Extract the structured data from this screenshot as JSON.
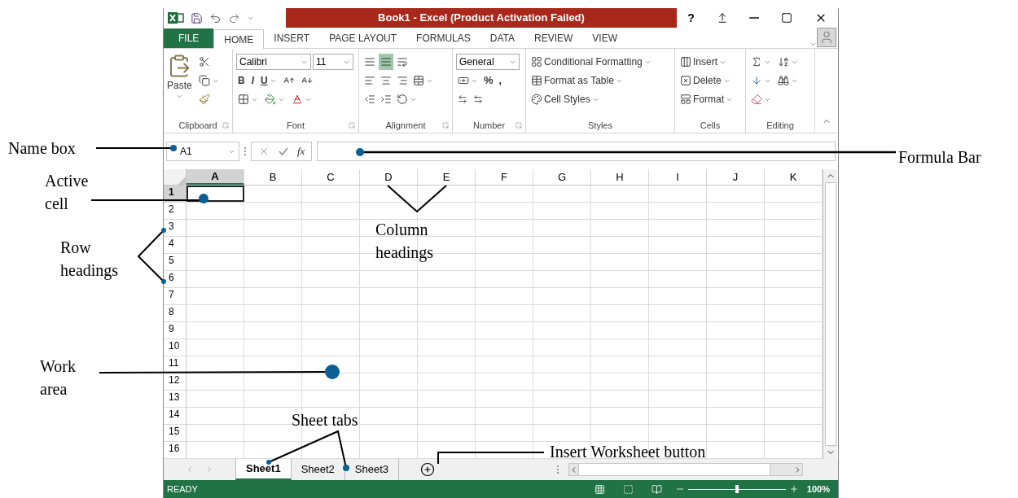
{
  "title_bar": {
    "title": "Book1 -  Excel (Product Activation Failed)",
    "help": "?"
  },
  "tabs": [
    {
      "label": "FILE",
      "kind": "file",
      "selected": false
    },
    {
      "label": "HOME",
      "kind": "tab",
      "selected": true
    },
    {
      "label": "INSERT",
      "kind": "tab",
      "selected": false
    },
    {
      "label": "PAGE LAYOUT",
      "kind": "tab",
      "selected": false
    },
    {
      "label": "FORMULAS",
      "kind": "tab",
      "selected": false
    },
    {
      "label": "DATA",
      "kind": "tab",
      "selected": false
    },
    {
      "label": "REVIEW",
      "kind": "tab",
      "selected": false
    },
    {
      "label": "VIEW",
      "kind": "tab",
      "selected": false
    }
  ],
  "ribbon": {
    "clipboard": {
      "label": "Clipboard",
      "paste": "Paste"
    },
    "font": {
      "label": "Font",
      "font_name": "Calibri",
      "font_size": "11",
      "bold": "B",
      "italic": "I",
      "underline": "U"
    },
    "alignment": {
      "label": "Alignment"
    },
    "number": {
      "label": "Number",
      "format": "General",
      "percent": "%",
      "comma": ","
    },
    "styles": {
      "label": "Styles",
      "items": [
        "Conditional Formatting",
        "Format as Table",
        "Cell Styles"
      ]
    },
    "cells": {
      "label": "Cells",
      "items": [
        "Insert",
        "Delete",
        "Format"
      ]
    },
    "editing": {
      "label": "Editing"
    }
  },
  "formula_bar": {
    "name_box": "A1",
    "function_label": "fx"
  },
  "columns": [
    {
      "label": "A",
      "selected": true
    },
    {
      "label": "B",
      "selected": false
    },
    {
      "label": "C",
      "selected": false
    },
    {
      "label": "D",
      "selected": false
    },
    {
      "label": "E",
      "selected": false
    },
    {
      "label": "F",
      "selected": false
    },
    {
      "label": "G",
      "selected": false
    },
    {
      "label": "H",
      "selected": false
    },
    {
      "label": "I",
      "selected": false
    },
    {
      "label": "J",
      "selected": false
    },
    {
      "label": "K",
      "selected": false
    }
  ],
  "rows": [
    {
      "label": "1",
      "selected": true
    },
    {
      "label": "2",
      "selected": false
    },
    {
      "label": "3",
      "selected": false
    },
    {
      "label": "4",
      "selected": false
    },
    {
      "label": "5",
      "selected": false
    },
    {
      "label": "6",
      "selected": false
    },
    {
      "label": "7",
      "selected": false
    },
    {
      "label": "8",
      "selected": false
    },
    {
      "label": "9",
      "selected": false
    },
    {
      "label": "10",
      "selected": false
    },
    {
      "label": "11",
      "selected": false
    },
    {
      "label": "12",
      "selected": false
    },
    {
      "label": "13",
      "selected": false
    },
    {
      "label": "14",
      "selected": false
    },
    {
      "label": "15",
      "selected": false
    },
    {
      "label": "16",
      "selected": false
    }
  ],
  "sheet_tabs": [
    {
      "label": "Sheet1",
      "selected": true
    },
    {
      "label": "Sheet2",
      "selected": false
    },
    {
      "label": "Sheet3",
      "selected": false
    }
  ],
  "status_bar": {
    "status": "READY",
    "zoom": "100%",
    "level": 0.5
  },
  "annotations": [
    {
      "label": "Name box"
    },
    {
      "label": "Active cell"
    },
    {
      "label": "Row headings"
    },
    {
      "label": "Column headings"
    },
    {
      "label": "Work area"
    },
    {
      "label": "Sheet tabs"
    },
    {
      "label": "Insert Worksheet button"
    },
    {
      "label": "Formula Bar"
    }
  ]
}
